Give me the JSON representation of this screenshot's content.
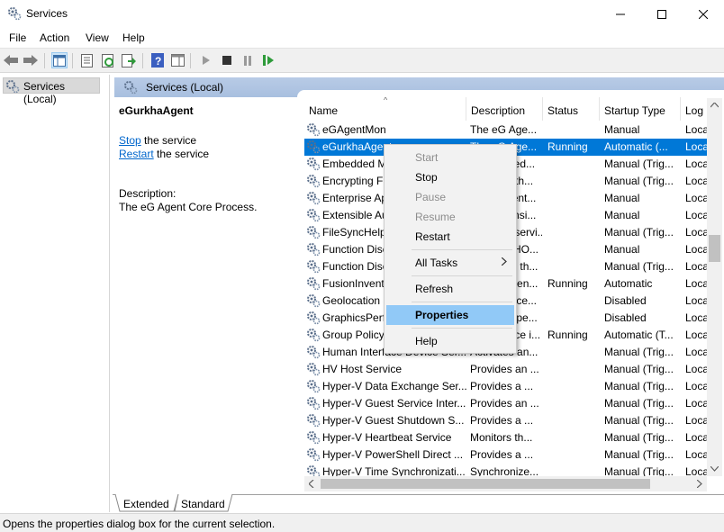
{
  "window": {
    "title": "Services"
  },
  "menu": [
    "File",
    "Action",
    "View",
    "Help"
  ],
  "tree": {
    "root": "Services (Local)"
  },
  "pane": {
    "header": "Services (Local)",
    "selected_service": "eGurkhaAgent",
    "stop_link": "Stop",
    "stop_suffix": " the service",
    "restart_link": "Restart",
    "restart_suffix": " the service",
    "desc_label": "Description:",
    "desc_text": "The eG Agent Core Process."
  },
  "columns": [
    "Name",
    "Description",
    "Status",
    "Startup Type",
    "Log"
  ],
  "rows": [
    {
      "name": "eGAgentMon",
      "desc": "The eG Age...",
      "status": "",
      "startup": "Manual",
      "logon": "Loca"
    },
    {
      "name": "eGurkhaAgent",
      "desc": "The eG Age...",
      "status": "Running",
      "startup": "Automatic (...",
      "logon": "Loca"
    },
    {
      "name": "Embedded Mode",
      "desc": "The Embed...",
      "status": "",
      "startup": "Manual (Trig...",
      "logon": "Loca"
    },
    {
      "name": "Encrypting File System (EFS)",
      "desc": "Provides th...",
      "status": "",
      "startup": "Manual (Trig...",
      "logon": "Loca"
    },
    {
      "name": "Enterprise App Management",
      "desc": "Enables ent...",
      "status": "",
      "startup": "Manual",
      "logon": "Loca"
    },
    {
      "name": "Extensible Authentication",
      "desc": "The Extensi...",
      "status": "",
      "startup": "Manual",
      "logon": "Loca"
    },
    {
      "name": "FileSyncHelper",
      "desc": "FileSync servi...",
      "status": "",
      "startup": "Manual (Trig...",
      "logon": "Loca"
    },
    {
      "name": "Function Discovery Provider",
      "desc": "The FDPHO...",
      "status": "",
      "startup": "Manual",
      "logon": "Loca"
    },
    {
      "name": "Function Discovery Resource",
      "desc": "Publishes th...",
      "status": "",
      "startup": "Manual (Trig...",
      "logon": "Loca"
    },
    {
      "name": "FusionInventory Agent",
      "desc": "FusionInven...",
      "status": "Running",
      "startup": "Automatic",
      "logon": "Loca"
    },
    {
      "name": "Geolocation Service",
      "desc": "This service...",
      "status": "",
      "startup": "Disabled",
      "logon": "Loca"
    },
    {
      "name": "GraphicsPerfSvc",
      "desc": "Graphics pe...",
      "status": "",
      "startup": "Disabled",
      "logon": "Loca"
    },
    {
      "name": "Group Policy Client",
      "desc": "The service i...",
      "status": "Running",
      "startup": "Automatic (T...",
      "logon": "Loca"
    },
    {
      "name": "Human Interface Device Ser...",
      "desc": "Activates an...",
      "status": "",
      "startup": "Manual (Trig...",
      "logon": "Loca"
    },
    {
      "name": "HV Host Service",
      "desc": "Provides an ...",
      "status": "",
      "startup": "Manual (Trig...",
      "logon": "Loca"
    },
    {
      "name": "Hyper-V Data Exchange Ser...",
      "desc": "Provides a ...",
      "status": "",
      "startup": "Manual (Trig...",
      "logon": "Loca"
    },
    {
      "name": "Hyper-V Guest Service Inter...",
      "desc": "Provides an ...",
      "status": "",
      "startup": "Manual (Trig...",
      "logon": "Loca"
    },
    {
      "name": "Hyper-V Guest Shutdown S...",
      "desc": "Provides a ...",
      "status": "",
      "startup": "Manual (Trig...",
      "logon": "Loca"
    },
    {
      "name": "Hyper-V Heartbeat Service",
      "desc": "Monitors th...",
      "status": "",
      "startup": "Manual (Trig...",
      "logon": "Loca"
    },
    {
      "name": "Hyper-V PowerShell Direct ...",
      "desc": "Provides a ...",
      "status": "",
      "startup": "Manual (Trig...",
      "logon": "Loca"
    },
    {
      "name": "Hyper-V Time Synchronizati...",
      "desc": "Synchronize...",
      "status": "",
      "startup": "Manual (Trig...",
      "logon": "Loca"
    }
  ],
  "tabs": [
    "Extended",
    "Standard"
  ],
  "context_menu": {
    "start": "Start",
    "stop": "Stop",
    "pause": "Pause",
    "resume": "Resume",
    "restart": "Restart",
    "all_tasks": "All Tasks",
    "refresh": "Refresh",
    "properties": "Properties",
    "help": "Help"
  },
  "status_text": "Opens the properties dialog box for the current selection.",
  "colors": {
    "selection": "#0078d7",
    "menu_highlight": "#91c9f7",
    "header": "#b8cbe6"
  }
}
